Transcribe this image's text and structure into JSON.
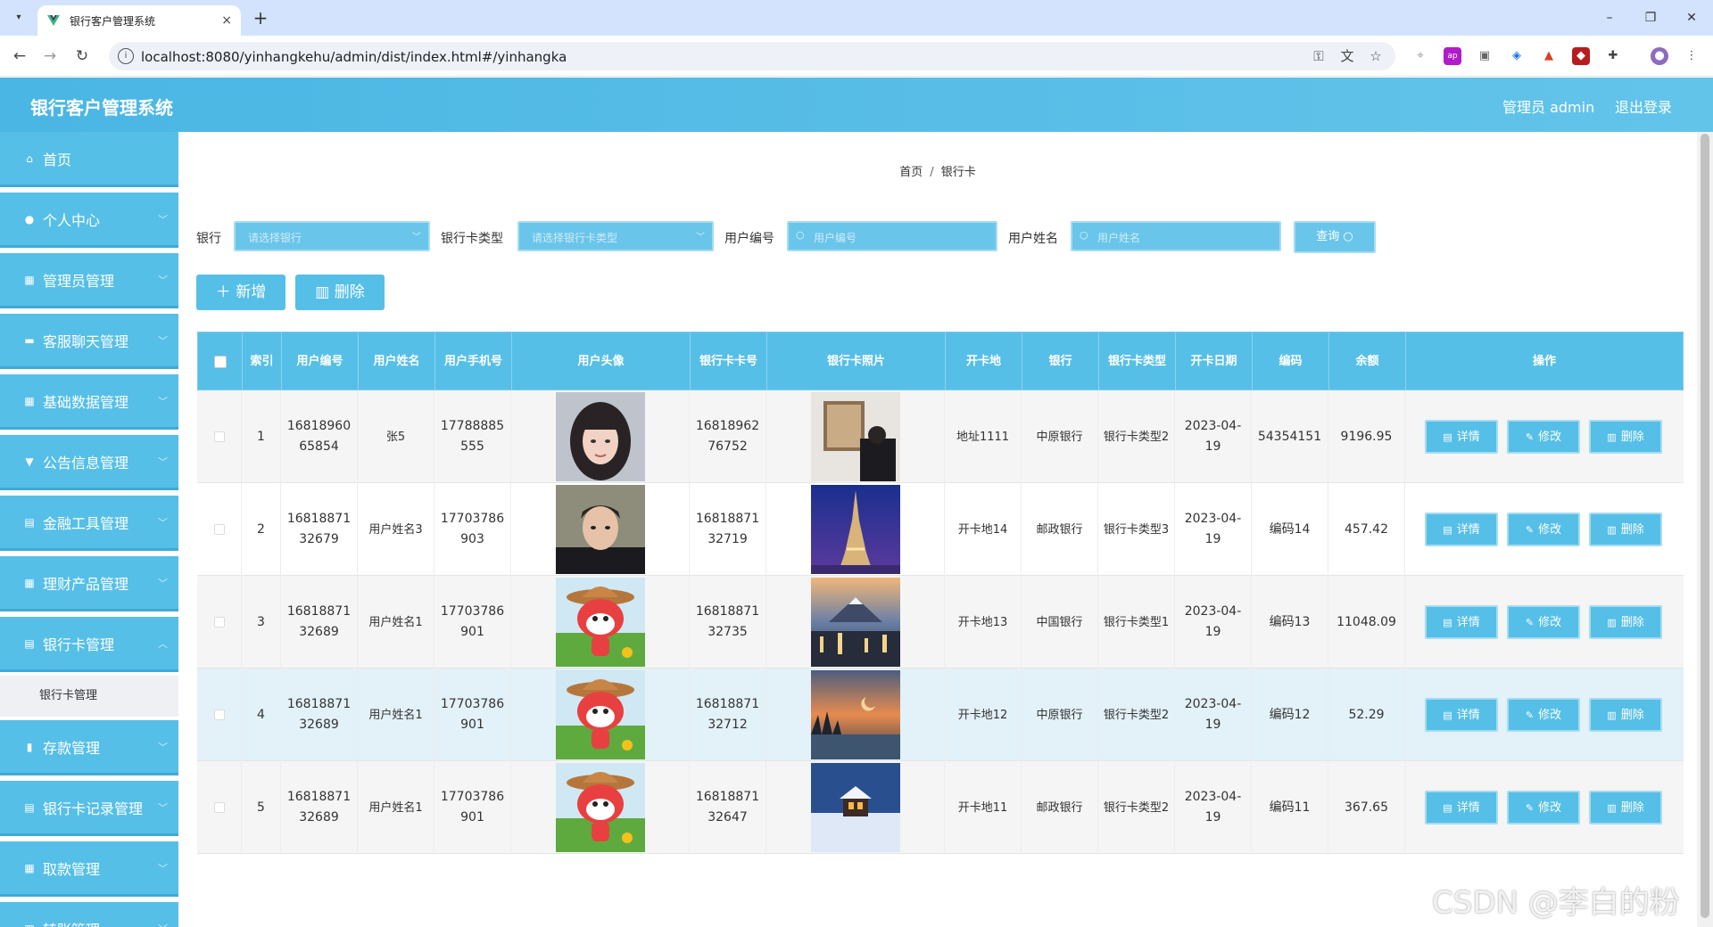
{
  "browser": {
    "tab_title": "银行客户管理系统",
    "tab_close": "×",
    "new_tab": "+",
    "url": "localhost:8080/yinhangkehu/admin/dist/index.html#/yinhangka"
  },
  "header": {
    "title": "银行客户管理系统",
    "user_label": "管理员 admin",
    "logout_label": "退出登录"
  },
  "sidebar": {
    "items": [
      {
        "label": "首页",
        "icon": "home-icon"
      },
      {
        "label": "个人中心",
        "icon": "user-icon"
      },
      {
        "label": "管理员管理",
        "icon": "grid-icon"
      },
      {
        "label": "客服聊天管理",
        "icon": "chat-icon"
      },
      {
        "label": "基础数据管理",
        "icon": "grid-icon"
      },
      {
        "label": "公告信息管理",
        "icon": "bullhorn-icon"
      },
      {
        "label": "金融工具管理",
        "icon": "doc-icon"
      },
      {
        "label": "理财产品管理",
        "icon": "grid-icon"
      },
      {
        "label": "银行卡管理",
        "icon": "doc-icon"
      },
      {
        "label": "存款管理",
        "icon": "chart-icon"
      },
      {
        "label": "银行卡记录管理",
        "icon": "doc-icon"
      },
      {
        "label": "取款管理",
        "icon": "grid-icon"
      },
      {
        "label": "转账管理",
        "icon": "grid-icon"
      }
    ],
    "active_sub": "银行卡管理"
  },
  "breadcrumb": {
    "home": "首页",
    "sep": "/",
    "current": "银行卡"
  },
  "filters": {
    "bank_label": "银行",
    "bank_placeholder": "请选择银行",
    "card_type_label": "银行卡类型",
    "card_type_placeholder": "请选择银行卡类型",
    "user_no_label": "用户编号",
    "user_no_placeholder": "用户编号",
    "user_name_label": "用户姓名",
    "user_name_placeholder": "用户姓名",
    "query_label": "查询"
  },
  "actions": {
    "add": "新增",
    "delete": "删除"
  },
  "table": {
    "headers": [
      "索引",
      "用户编号",
      "用户姓名",
      "用户手机号",
      "用户头像",
      "银行卡卡号",
      "银行卡照片",
      "开卡地",
      "银行",
      "银行卡类型",
      "开卡日期",
      "编码",
      "余额",
      "操作"
    ],
    "rows": [
      {
        "idx": "1",
        "user_no": "1681896065854",
        "name": "张5",
        "phone": "17788885555",
        "card_no": "1681896276752",
        "place": "地址1111",
        "bank": "中原银行",
        "type": "银行卡类型2",
        "date": "2023-04-19",
        "code": "54354151",
        "balance": "9196.95"
      },
      {
        "idx": "2",
        "user_no": "1681887132679",
        "name": "用户姓名3",
        "phone": "17703786903",
        "card_no": "1681887132719",
        "place": "开卡地14",
        "bank": "邮政银行",
        "type": "银行卡类型3",
        "date": "2023-04-19",
        "code": "编码14",
        "balance": "457.42"
      },
      {
        "idx": "3",
        "user_no": "1681887132689",
        "name": "用户姓名1",
        "phone": "17703786901",
        "card_no": "1681887132735",
        "place": "开卡地13",
        "bank": "中国银行",
        "type": "银行卡类型1",
        "date": "2023-04-19",
        "code": "编码13",
        "balance": "11048.09"
      },
      {
        "idx": "4",
        "user_no": "1681887132689",
        "name": "用户姓名1",
        "phone": "17703786901",
        "card_no": "1681887132712",
        "place": "开卡地12",
        "bank": "中原银行",
        "type": "银行卡类型2",
        "date": "2023-04-19",
        "code": "编码12",
        "balance": "52.29"
      },
      {
        "idx": "5",
        "user_no": "1681887132689",
        "name": "用户姓名1",
        "phone": "17703786901",
        "card_no": "1681887132647",
        "place": "开卡地11",
        "bank": "邮政银行",
        "type": "银行卡类型2",
        "date": "2023-04-19",
        "code": "编码11",
        "balance": "367.65"
      }
    ],
    "row_buttons": {
      "detail": "详情",
      "edit": "修改",
      "delete": "删除"
    }
  },
  "watermark": "CSDN @李白的粉",
  "colors": {
    "primary": "#56bfe7",
    "header_gradient_end": "#63c4ea",
    "highlight_row": "#e3f1f8",
    "alt_row": "#f5f5f5"
  }
}
